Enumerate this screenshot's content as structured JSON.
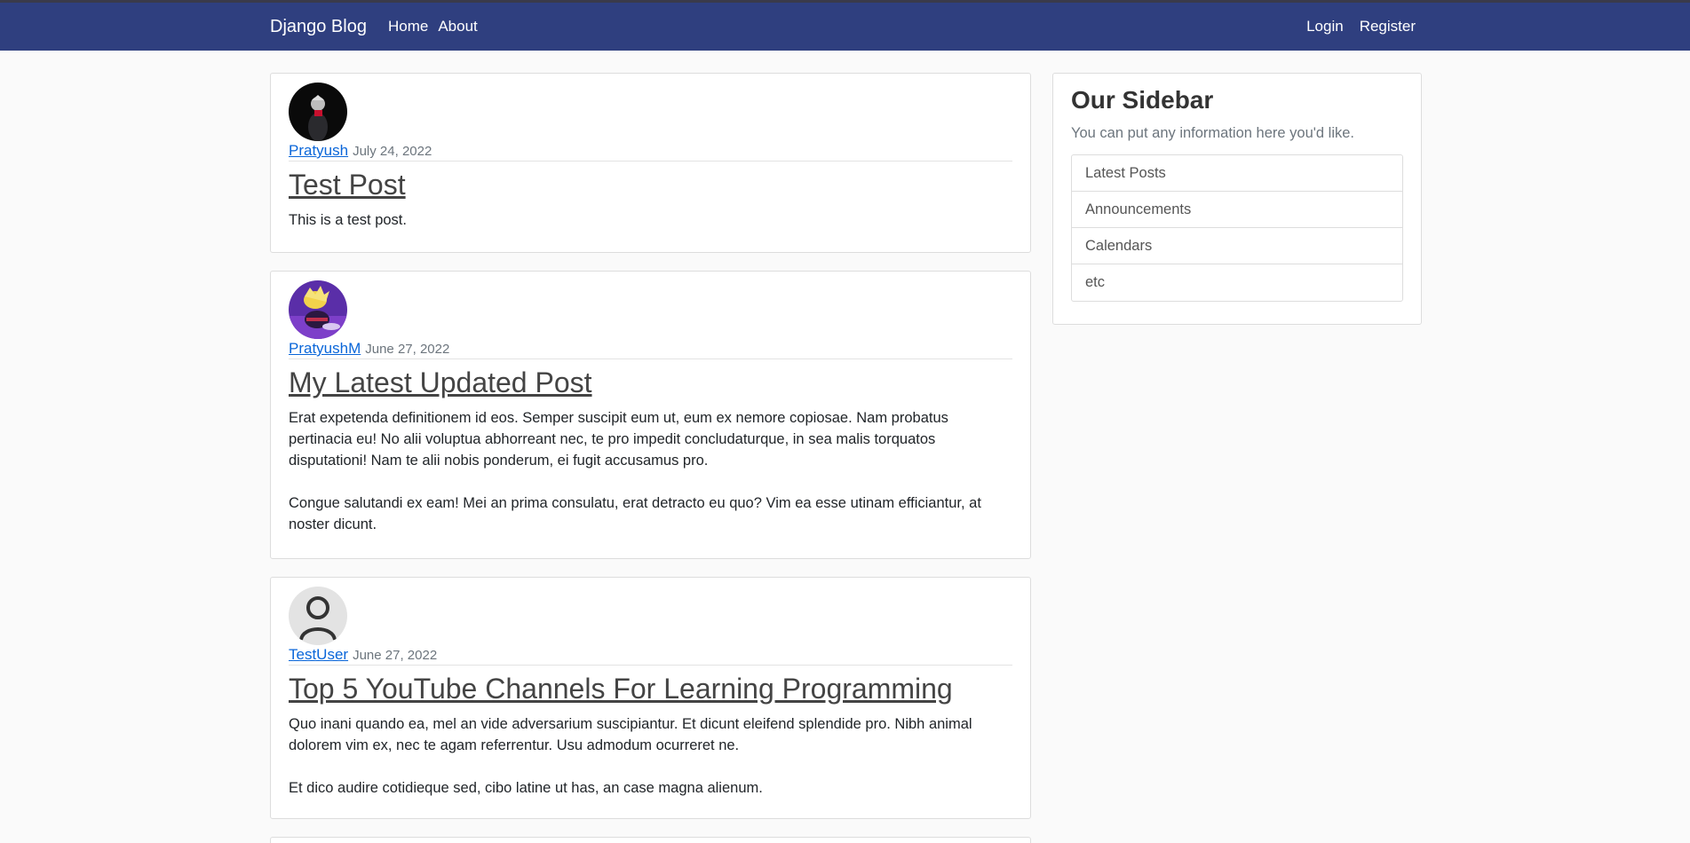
{
  "navbar": {
    "brand": "Django Blog",
    "links": [
      "Home",
      "About"
    ],
    "right_links": [
      "Login",
      "Register"
    ]
  },
  "posts": [
    {
      "author": "Pratyush",
      "date": "July 24, 2022",
      "title": "Test Post",
      "content": "This is a test post.",
      "avatar_icon": "dark-figure-avatar"
    },
    {
      "author": "PratyushM",
      "date": "June 27, 2022",
      "title": "My Latest Updated Post",
      "content": "Erat expetenda definitionem id eos. Semper suscipit eum ut, eum ex nemore copiosae. Nam probatus pertinacia eu! No alii voluptua abhorreant nec, te pro impedit concludaturque, in sea malis torquatos disputationi! Nam te alii nobis ponderum, ei fugit accusamus pro.\n\nCongue salutandi ex eam! Mei an prima consulatu, erat detracto eu quo? Vim ea esse utinam efficiantur, at noster dicunt.",
      "avatar_icon": "purple-character-avatar"
    },
    {
      "author": "TestUser",
      "date": "June 27, 2022",
      "title": "Top 5 YouTube Channels For Learning Programming",
      "content": "Quo inani quando ea, mel an vide adversarium suscipiantur. Et dicunt eleifend splendide pro. Nibh animal dolorem vim ex, nec te agam referrentur. Usu admodum ocurreret ne.\n\nEt dico audire cotidieque sed, cibo latine ut has, an case magna alienum.",
      "avatar_icon": "default-user-avatar"
    }
  ],
  "sidebar": {
    "title": "Our Sidebar",
    "description": "You can put any information here you'd like.",
    "items": [
      "Latest Posts",
      "Announcements",
      "Calendars",
      "etc"
    ]
  },
  "colors": {
    "navbar": "#2f3f7f",
    "link": "#0a66d9",
    "background": "#fafafa"
  }
}
